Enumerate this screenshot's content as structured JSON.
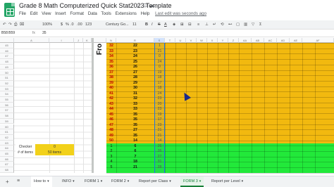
{
  "title": "Grade 8 Math Computerized Quick Stat2023 Template",
  "menu": [
    "File",
    "Edit",
    "View",
    "Insert",
    "Format",
    "Data",
    "Tools",
    "Extensions",
    "Help"
  ],
  "last_edit": "Last edit was seconds ago",
  "toolbar": {
    "zoom": "100%",
    "currency": "$",
    "percent": "%",
    "decimal1": ".0",
    "decimal2": ".00",
    "number_format": "123",
    "font": "Century Go...",
    "font_size": "11",
    "bold": "B",
    "italic": "I",
    "strike": "S",
    "text_color": "A"
  },
  "formula": {
    "cell_ref": "B58:B59",
    "fx": "fx",
    "value": "35"
  },
  "column_headers_left": [
    "A",
    "I",
    "J",
    "K"
  ],
  "column_headers_right": [
    "N",
    "R",
    "S",
    "T",
    "U",
    "V",
    "W",
    "X",
    "Y",
    "Z",
    "AA",
    "AB",
    "AC",
    "AD",
    "AE",
    "AF"
  ],
  "row_numbers": [
    "45",
    "46",
    "47",
    "48",
    "49",
    "50",
    "51",
    "52",
    "53",
    "54",
    "55",
    "56",
    "57",
    "58",
    "59",
    "60",
    "61",
    "62",
    "63",
    "64",
    "65",
    "66",
    "67",
    "68"
  ],
  "fro_label": "Fro",
  "yellow_rows": [
    {
      "n": "32",
      "r": "22",
      "s": "1"
    },
    {
      "n": "33",
      "r": "23",
      "s": "21"
    },
    {
      "n": "34",
      "r": "24",
      "s": "0"
    },
    {
      "n": "35",
      "r": "25",
      "s": "24"
    },
    {
      "n": "36",
      "r": "26",
      "s": "0"
    },
    {
      "n": "37",
      "r": "27",
      "s": "19"
    },
    {
      "n": "38",
      "r": "28",
      "s": "18"
    },
    {
      "n": "39",
      "r": "29",
      "s": "17"
    },
    {
      "n": "40",
      "r": "30",
      "s": "18"
    },
    {
      "n": "41",
      "r": "31",
      "s": "24"
    },
    {
      "n": "42",
      "r": "32",
      "s": "23"
    },
    {
      "n": "43",
      "r": "33",
      "s": "20"
    },
    {
      "n": "44",
      "r": "33",
      "s": "23"
    },
    {
      "n": "45",
      "r": "35",
      "s": "19"
    },
    {
      "n": "46",
      "r": "35",
      "s": "17"
    },
    {
      "n": "47",
      "r": "35",
      "s": "23"
    },
    {
      "n": "48",
      "r": "27",
      "s": "21"
    },
    {
      "n": "49",
      "r": "35",
      "s": "21"
    },
    {
      "n": "50",
      "r": "14",
      "s": "14"
    }
  ],
  "green_rows": [
    {
      "n": "1",
      "r": "6",
      "s": "26"
    },
    {
      "n": "2",
      "r": "6",
      "s": "26"
    },
    {
      "n": "3",
      "r": "7",
      "s": "27"
    },
    {
      "n": "4",
      "r": "18",
      "s": "31"
    },
    {
      "n": "5",
      "r": "21",
      "s": "28"
    }
  ],
  "checker_label": "Checker",
  "checker_value": "0",
  "items_label": "# of items",
  "items_value": "50 items",
  "tabs": [
    "How to",
    "INFO",
    "FORM 1",
    "FORM 2",
    "Report per Class",
    "FORM 3",
    "Report per Level"
  ],
  "active_tab": "FORM 3",
  "colors": {
    "yellow": "#f2b90f",
    "green": "#22e93a",
    "red_text": "#c00000",
    "sheets_green": "#188038"
  }
}
